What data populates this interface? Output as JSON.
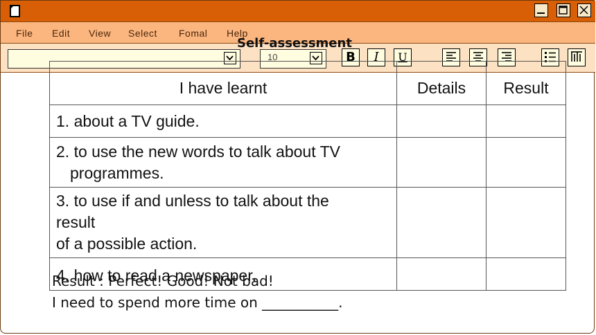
{
  "menubar": {
    "items": [
      "File",
      "Edit",
      "View",
      "Select",
      "Fomal",
      "Help"
    ]
  },
  "toolbar": {
    "font_size": "10",
    "bold_label": "B",
    "italic_label": "I",
    "underline_label": "U"
  },
  "heading": "Self-assessment",
  "table": {
    "headers": [
      "I have learnt",
      "Details",
      "Result"
    ],
    "rows": [
      {
        "text": "1. about a TV guide."
      },
      {
        "line1": "2. to use the new words to talk about TV",
        "line2": "programmes."
      },
      {
        "line1": "3. to use if and unless to talk about the",
        "line2": "result",
        "line3": "of a possible action."
      },
      {
        "text": "4. how to read a newspaper."
      }
    ]
  },
  "footer": {
    "result_line": "Result : Perfect! Good! Not bad!",
    "need_line": "I need to spend more time on ___________."
  },
  "colors": {
    "titlebar": "#d85f06",
    "menubar": "#fbb680",
    "toolbar": "#fde1c3"
  }
}
